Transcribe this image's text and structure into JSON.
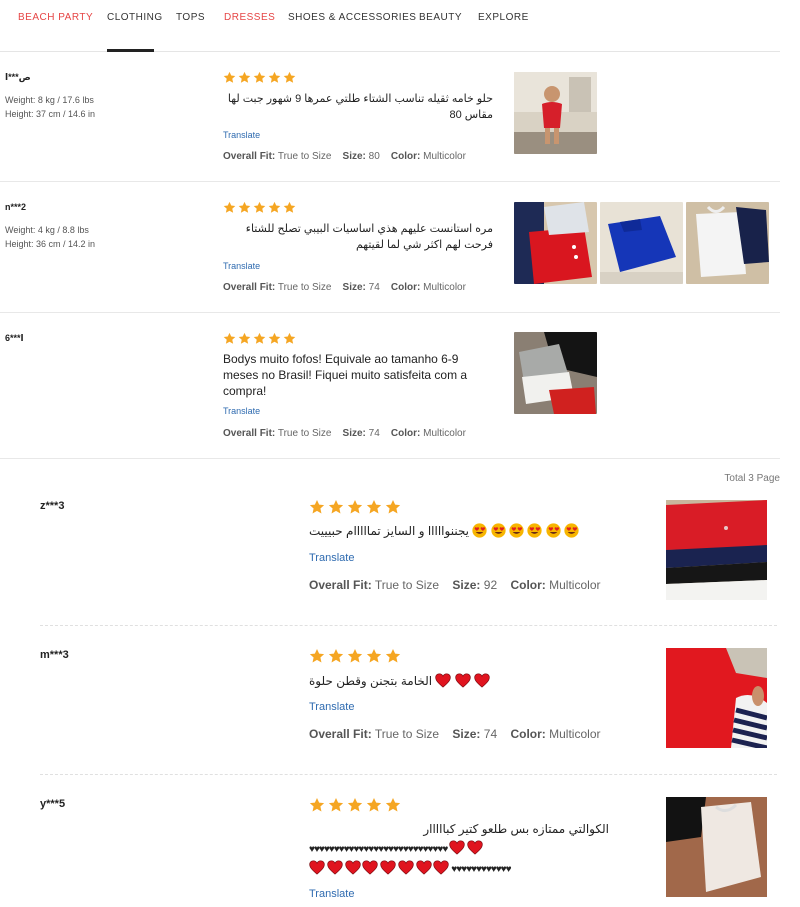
{
  "nav": {
    "tabs": [
      "BEACH PARTY",
      "CLOTHING",
      "TOPS",
      "DRESSES",
      "SHOES & ACCESSORIES",
      "BEAUTY",
      "EXPLORE"
    ]
  },
  "reviews": [
    {
      "user": "ص***ا",
      "weight": "Weight: 8 kg / 17.6 lbs",
      "height": "Height: 37 cm / 14.6 in",
      "rating": 5,
      "text": "حلو خامه ثقيله تناسب الشتاء طلتي عمرها 9 شهور جبت لها مقاس 80",
      "translate": "Translate",
      "fit_label": "Overall Fit:",
      "fit_value": "True to Size",
      "size_label": "Size:",
      "size_value": "80",
      "color_label": "Color:",
      "color_value": "Multicolor"
    },
    {
      "user": "n***2",
      "weight": "Weight: 4 kg / 8.8 lbs",
      "height": "Height: 36 cm / 14.2 in",
      "rating": 5,
      "text": "مره استانست عليهم هذي اساسيات البيبي تصلح للشتاء فرحت لهم اكثر شي لما لقيتهم",
      "translate": "Translate",
      "fit_label": "Overall Fit:",
      "fit_value": "True to Size",
      "size_label": "Size:",
      "size_value": "74",
      "color_label": "Color:",
      "color_value": "Multicolor"
    },
    {
      "user": "ا***6",
      "weight": "",
      "height": "",
      "rating": 5,
      "text": "Bodys muito fofos! Equivale ao tamanho 6-9 meses no Brasil! Fiquei muito satisfeita com a compra!",
      "translate": "Translate",
      "fit_label": "Overall Fit:",
      "fit_value": "True to Size",
      "size_label": "Size:",
      "size_value": "74",
      "color_label": "Color:",
      "color_value": "Multicolor"
    }
  ],
  "pagination": {
    "total": "Total 3 Page"
  },
  "reviews2": [
    {
      "user": "z***3",
      "rating": 5,
      "text": "يجننوااااا و السايز تمااااام حبيييت",
      "translate": "Translate",
      "fit_label": "Overall Fit:",
      "fit_value": "True to Size",
      "size_label": "Size:",
      "size_value": "92",
      "color_label": "Color:",
      "color_value": "Multicolor"
    },
    {
      "user": "m***3",
      "rating": 5,
      "text": "الخامة بتجنن وقطن حلوة",
      "translate": "Translate",
      "fit_label": "Overall Fit:",
      "fit_value": "True to Size",
      "size_label": "Size:",
      "size_value": "74",
      "color_label": "Color:",
      "color_value": "Multicolor"
    },
    {
      "user": "y***5",
      "rating": 5,
      "text": "الكوالتي ممتازه بس طلعو كتير كبااااار",
      "hearts_row": "♥♥♥♥♥♥♥♥♥♥♥♥♥♥♥♥♥♥♥♥♥♥♥♥♥♥♥♥",
      "hearts_row2": "♥♥♥♥♥♥♥♥♥♥♥♥",
      "translate": "Translate"
    }
  ],
  "colors": {
    "star": "#f5a623",
    "link": "#2f6bb0",
    "accent": "#e64545"
  }
}
